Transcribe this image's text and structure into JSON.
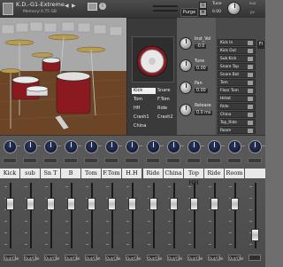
{
  "header": {
    "title": "K.D.-G1-Extreme",
    "memory_label": "Memory:",
    "memory_value": "0.75 GB",
    "purge_label": "Purge",
    "tune_label": "Tune",
    "tune_value": "0.00",
    "aux_label": "aux",
    "pv_label": "pv"
  },
  "mixer_side": {
    "instr_volume_label": "Inst_Vol",
    "instr_volume_value": "-0.0",
    "tune_label": "Tune",
    "tune_value": "0.00",
    "pan_label": "Pan",
    "pan_value": "0.00",
    "release_label": "Release",
    "release_value": "0.0 ms"
  },
  "articulations": {
    "left": [
      "Kick",
      "Tom",
      "HH",
      "Crash1",
      "China"
    ],
    "right": [
      "Snare",
      "F.Tom",
      "Ride",
      "Crash2"
    ],
    "selected": "Kick"
  },
  "routing": {
    "rows": [
      "Kick In",
      "Kick Out",
      "Sub Kick",
      "Snare Top",
      "Snare Bot",
      "Tom",
      "Floor Tom",
      "HiHat",
      "Ride",
      "China",
      "Top_Ride",
      "Room"
    ],
    "sidebar_label": "Fl"
  },
  "channels": [
    {
      "label": "Kick",
      "out": "Out/Chn"
    },
    {
      "label": "sub",
      "out": "Out/Chn"
    },
    {
      "label": "Sn T",
      "out": "Out/Chn"
    },
    {
      "label": "B",
      "out": "Out/Chn"
    },
    {
      "label": "Tom",
      "out": "Out/Chn"
    },
    {
      "label": "F.Tom",
      "out": "Out/Chn"
    },
    {
      "label": "H.H",
      "out": "Out/Chn"
    },
    {
      "label": "Ride",
      "out": "Out/Chn"
    },
    {
      "label": "China",
      "out": "Out/Chn"
    },
    {
      "label": "Top HH",
      "out": "Out/Chn"
    },
    {
      "label": "Ride",
      "out": "Out/Chn"
    },
    {
      "label": "Room",
      "out": "Out/Chn"
    }
  ],
  "colors": {
    "accent_knob": "#2d3a66",
    "selected_item": "#f0f0f0",
    "drum_shell": "#8a1a1f"
  }
}
